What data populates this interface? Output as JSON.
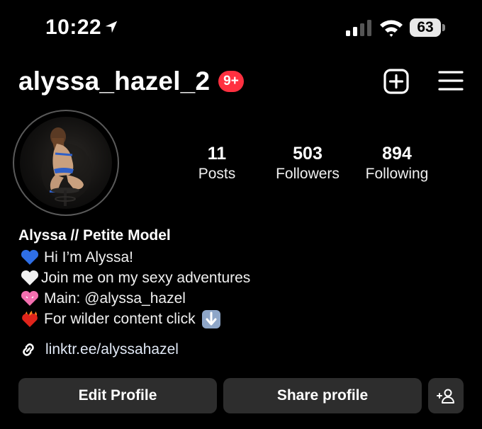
{
  "status_bar": {
    "time": "10:22",
    "battery": "63",
    "icons": [
      "location-arrow-icon",
      "cellular-signal-icon",
      "wifi-icon",
      "battery-icon"
    ]
  },
  "header": {
    "username": "alyssa_hazel_2",
    "notification_badge": "9+",
    "badge_color": "#ff3040",
    "icons": [
      "new-post-plus-icon",
      "hamburger-menu-icon"
    ]
  },
  "profile": {
    "avatar_icon": "profile-photo",
    "stats": [
      {
        "value": "11",
        "label": "Posts"
      },
      {
        "value": "503",
        "label": "Followers"
      },
      {
        "value": "894",
        "label": "Following"
      }
    ]
  },
  "bio": {
    "name": "Alyssa // Petite Model",
    "lines": [
      {
        "icon": "blue-heart-emoji",
        "text": " Hi I’m Alyssa!"
      },
      {
        "icon": "white-heart-emoji",
        "text": "Join me on my sexy adventures"
      },
      {
        "icon": "pink-heart-emoji",
        "text": " Main: @alyssa_hazel"
      },
      {
        "icon": "heart-on-fire-emoji",
        "text": " For wilder content click"
      }
    ],
    "trailing_icon": "down-arrow-emoji",
    "link": "linktr.ee/alyssahazel",
    "link_icon": "link-chain-icon"
  },
  "actions": {
    "edit_label": "Edit Profile",
    "share_label": "Share profile",
    "add_person_icon": "add-person-icon",
    "button_color": "#2d2d2d"
  }
}
